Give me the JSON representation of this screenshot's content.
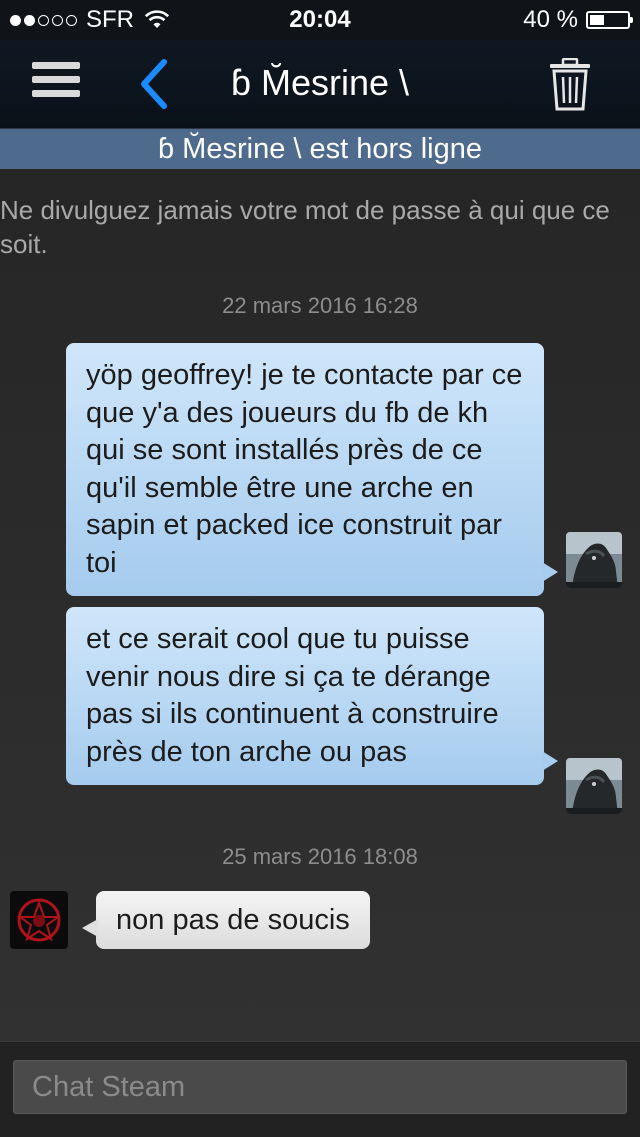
{
  "status_bar": {
    "carrier": "SFR",
    "time": "20:04",
    "battery_text": "40 %",
    "battery_level": 0.4,
    "signal_bars_filled": 2,
    "signal_bars_total": 5
  },
  "nav": {
    "title": "ɓ M̆esrine \\"
  },
  "status_strip": {
    "text": "ɓ M̆esrine \\ est hors ligne"
  },
  "chat": {
    "notice": "Ne divulguez jamais votre mot de passe à qui que ce soit.",
    "timestamps": [
      "22 mars 2016 16:28",
      "25 mars 2016 18:08"
    ],
    "messages": [
      {
        "direction": "outgoing",
        "text": "yöp geoffrey! je te contacte par ce que y'a des joueurs du fb de kh qui se sont installés près de ce qu'il semble être une arche en sapin et packed ice construit par toi"
      },
      {
        "direction": "outgoing",
        "text": "et ce serait cool que tu puisse venir nous dire si ça te dérange pas si ils continuent à construire près de ton arche ou pas"
      },
      {
        "direction": "incoming",
        "text": "non pas de soucis"
      }
    ]
  },
  "input": {
    "placeholder": "Chat Steam"
  },
  "colors": {
    "navbar": "#0f1822",
    "status_strip": "#4e6a8c",
    "outgoing_bubble": "#bcdaf5",
    "incoming_bubble": "#ececec",
    "accent": "#1a8cff"
  }
}
